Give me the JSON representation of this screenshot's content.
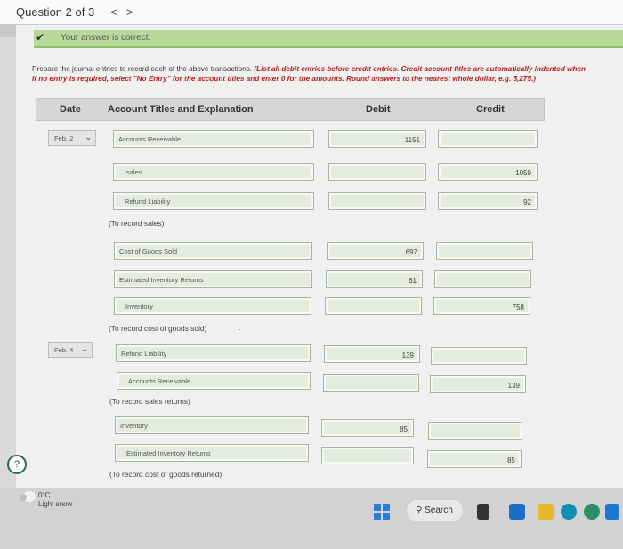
{
  "header": {
    "question_label": "Question 2 of 3",
    "prev": "<",
    "next": ">"
  },
  "banner": {
    "check": "✔",
    "message": "Your answer is correct."
  },
  "instructions": {
    "line1_plain": "Prepare the journal entries to record each of the above transactions. ",
    "line1_emph": "(List all debit entries before credit entries. Credit account titles are automatically indented when",
    "line2_emph": "If no entry is required, select \"No Entry\" for the account titles and enter 0 for the amounts. Round answers to the nearest whole dollar, e.g. 5,275.)"
  },
  "table": {
    "headers": {
      "date": "Date",
      "account": "Account Titles and Explanation",
      "debit": "Debit",
      "credit": "Credit"
    },
    "dates": [
      "Feb. 2",
      "Feb. 4"
    ],
    "rows": [
      {
        "account": "Accounts Receivable",
        "debit": "1151",
        "credit": ""
      },
      {
        "account": "sales",
        "debit": "",
        "credit": "1059"
      },
      {
        "account": "Refund Liability",
        "debit": "",
        "credit": "92"
      },
      {
        "account": "Cost of Goods Sold",
        "debit": "697",
        "credit": ""
      },
      {
        "account": "Estimated Inventory Returns",
        "debit": "61",
        "credit": ""
      },
      {
        "account": "Inventory",
        "debit": "",
        "credit": "758"
      },
      {
        "account": "Refund Liability",
        "debit": "139",
        "credit": ""
      },
      {
        "account": "Accounts Receivable",
        "debit": "",
        "credit": "139"
      },
      {
        "account": "Inventory",
        "debit": "85",
        "credit": ""
      },
      {
        "account": "Estimated Inventory Returns",
        "debit": "",
        "credit": "85"
      }
    ],
    "notes": [
      "(To record sales)",
      "(To record cost of goods sold)",
      "(To record sales returns)",
      "(To record cost of goods returned)"
    ]
  },
  "taskbar": {
    "temp": "0°C",
    "weather": "Light snow",
    "search": "Search"
  },
  "colors": {
    "banner": "#b8d99a",
    "field": "#e6ebe0",
    "accent": "#b51e1e"
  }
}
